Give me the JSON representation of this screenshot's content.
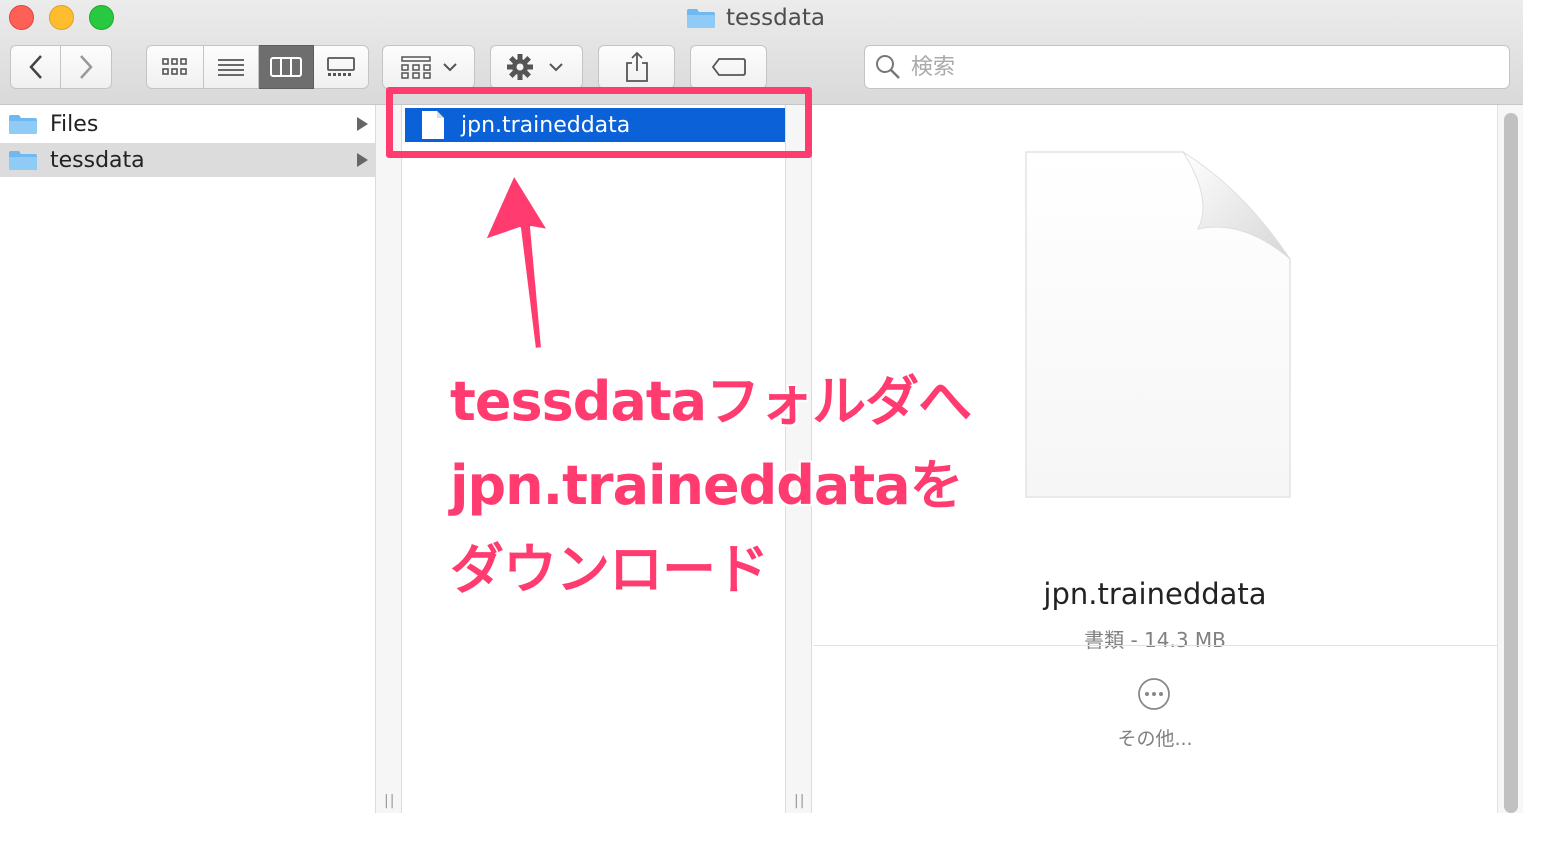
{
  "window": {
    "title": "tessdata"
  },
  "toolbar": {
    "back_icon": "chevron-left",
    "forward_icon": "chevron-right",
    "views": [
      "icon-view",
      "list-view",
      "column-view",
      "gallery-view"
    ],
    "active_view": "column-view",
    "group_icon": "group-by",
    "action_icon": "gear",
    "share_icon": "share",
    "tag_icon": "tag",
    "search_placeholder": "検索"
  },
  "sidebar_column": {
    "items": [
      {
        "label": "Files",
        "icon": "folder"
      },
      {
        "label": "tessdata",
        "icon": "folder",
        "selected": true
      }
    ]
  },
  "file_column": {
    "items": [
      {
        "label": "jpn.traineddata",
        "icon": "document",
        "selected": true
      }
    ]
  },
  "preview": {
    "filename": "jpn.traineddata",
    "meta": "書類 - 14.3 MB",
    "more_label": "その他..."
  },
  "annotation": {
    "lines": [
      "tessdataフォルダへ",
      "jpn.traineddataを",
      "ダウンロード"
    ],
    "color": "#ff3b70"
  },
  "colors": {
    "selection": "#0a61d8",
    "annotation": "#ff3b70",
    "folder": "#6fb8f0"
  }
}
